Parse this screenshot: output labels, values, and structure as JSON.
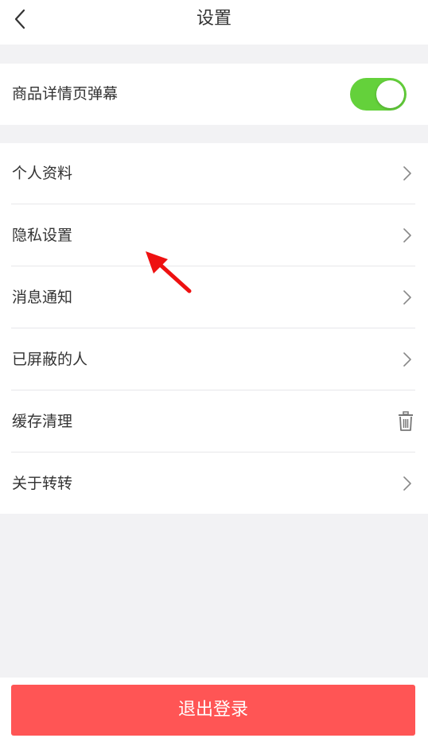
{
  "header": {
    "title": "设置",
    "back_icon": "chevron-left-icon"
  },
  "danmaku": {
    "label": "商品详情页弹幕",
    "enabled": true,
    "toggle_color": "#64d13b"
  },
  "menu": {
    "items": [
      {
        "label": "个人资料",
        "icon": "chevron-right-icon"
      },
      {
        "label": "隐私设置",
        "icon": "chevron-right-icon"
      },
      {
        "label": "消息通知",
        "icon": "chevron-right-icon"
      },
      {
        "label": "已屏蔽的人",
        "icon": "chevron-right-icon"
      },
      {
        "label": "缓存清理",
        "icon": "trash-icon"
      },
      {
        "label": "关于转转",
        "icon": "chevron-right-icon"
      }
    ]
  },
  "annotation": {
    "icon": "red-arrow-icon",
    "color": "#ee1111"
  },
  "footer": {
    "logout_label": "退出登录",
    "logout_color": "#ff5555"
  }
}
